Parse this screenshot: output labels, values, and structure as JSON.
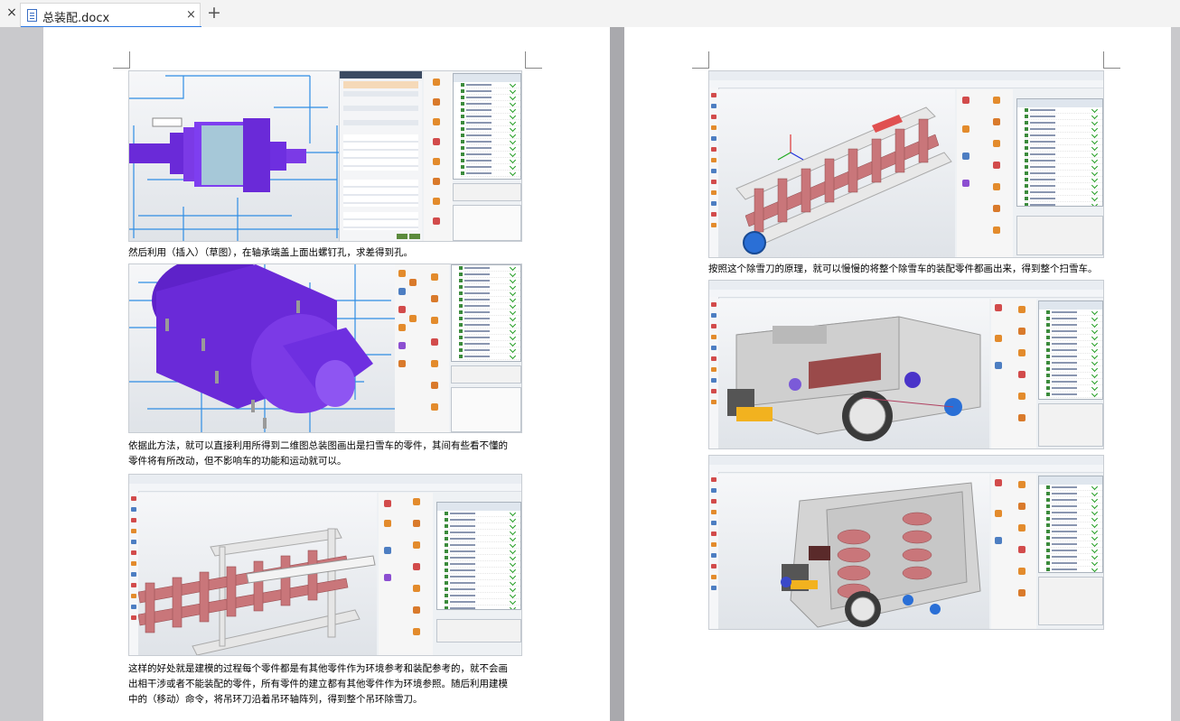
{
  "tabs": [
    {
      "title": "总装配.docx",
      "active": true
    }
  ],
  "tab_add_symbol": "+",
  "close_symbol": "×",
  "page_left": {
    "paragraph_1": "然后利用（插入）（草图），在轴承端盖上面出螺钉孔，求差得到孔。",
    "paragraph_2_lines": [
      "依据此方法，就可以直接利用所得到二维图总装图画出是扫雪车的零件，其间有些看不懂的",
      "零件将有所改动，但不影响车的功能和运动就可以。"
    ],
    "paragraph_3_lines": [
      "这样的好处就是建模的过程每个零件都是有其他零件作为环境参考和装配参考的，就不会画",
      "出相干涉或者不能装配的零件，所有零件的建立都有其他零件作为环境参照。随后利用建模",
      "中的（移动）命令，将吊环刀沿着吊环轴阵列，得到整个吊环除雪刀。"
    ]
  },
  "page_right": {
    "paragraph_1": "按照这个除雪刀的原理，就可以慢慢的将整个除雪车的装配零件都画出来，得到整个扫雪车。"
  },
  "colors": {
    "tab_accent": "#2b78e4",
    "purple_part": "#6a2ad8",
    "pink_part": "#c9767a",
    "blue_sketch": "#2f8de4",
    "check_green": "#1e9b1e"
  }
}
